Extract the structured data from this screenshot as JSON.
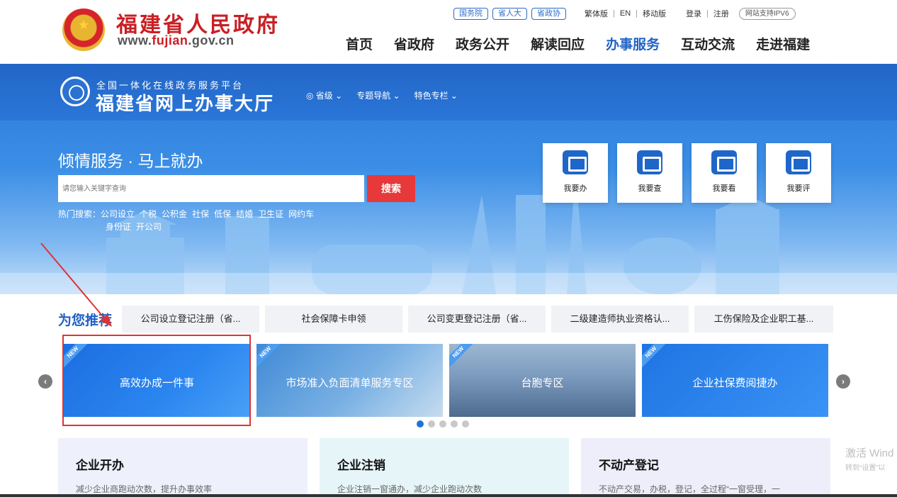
{
  "header": {
    "site_title": "福建省人民政府",
    "url_prefix": "www.",
    "url_highlight": "fujian",
    "url_suffix": ".gov.cn",
    "top_pills": [
      "国务院",
      "省人大",
      "省政协"
    ],
    "top_links": [
      "繁体版",
      "EN",
      "移动版"
    ],
    "auth_links": [
      "登录",
      "注册"
    ],
    "ipv6_badge": "网站支持IPV6",
    "nav": [
      "首页",
      "省政府",
      "政务公开",
      "解读回应",
      "办事服务",
      "互动交流",
      "走进福建"
    ],
    "active_nav": "办事服务"
  },
  "hall": {
    "subtitle": "全国一体化在线政务服务平台",
    "title": "福建省网上办事大厅",
    "region_nav": [
      "◎ 省级 ⌄",
      "专题导航 ⌄",
      "特色专栏 ⌄"
    ]
  },
  "hero": {
    "slogan": "倾情服务 · 马上就办",
    "search_placeholder": "请您输入关键字查询",
    "search_button": "搜索",
    "hot_label": "热门搜索：",
    "hot_keywords_row1": [
      "公司设立",
      "个税",
      "公积金",
      "社保",
      "低保",
      "结婚",
      "卫生证",
      "网约车"
    ],
    "hot_keywords_row2": [
      "身份证",
      "开公司"
    ],
    "quick_tiles": [
      {
        "label": "我要办",
        "icon": "clipboard-icon"
      },
      {
        "label": "我要查",
        "icon": "search-screen-icon"
      },
      {
        "label": "我要看",
        "icon": "view-icon"
      },
      {
        "label": "我要评",
        "icon": "comment-icon"
      }
    ]
  },
  "recommend": {
    "title": "为您推荐",
    "items": [
      "公司设立登记注册（省...",
      "社会保障卡申领",
      "公司变更登记注册（省...",
      "二级建造师执业资格认...",
      "工伤保险及企业职工基..."
    ]
  },
  "carousel": {
    "ribbon": "NEW",
    "banners": [
      "高效办成一件事",
      "市场准入负面清单服务专区",
      "台胞专区",
      "企业社保费阅捷办"
    ],
    "dot_count": 5,
    "active_dot": 0
  },
  "service_cards": [
    {
      "title": "企业开办",
      "desc": "减少企业商跑动次数，提升办事效率"
    },
    {
      "title": "企业注销",
      "desc": "企业注销一窗通办，减少企业跑动次数"
    },
    {
      "title": "不动产登记",
      "desc": "不动产交易，办税，登记，全过程“一窗受理，一"
    }
  ],
  "watermark": {
    "line1": "激活 Wind",
    "line2": "转到“设置”以"
  },
  "colors": {
    "brand_red": "#c91f24",
    "nav_active": "#2063c7",
    "hero_blue": "#2a78d8",
    "search_button": "#e7383a",
    "annotation_red": "#e03333"
  }
}
